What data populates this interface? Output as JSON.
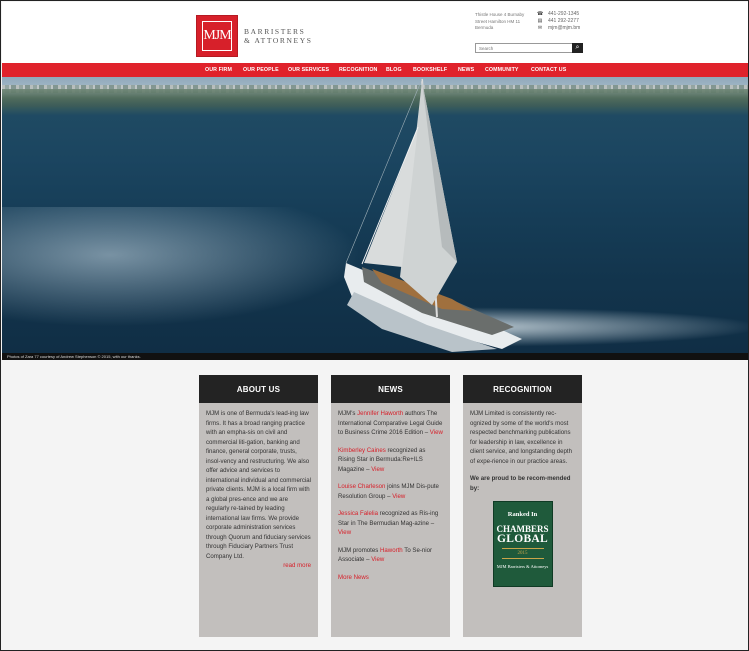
{
  "header": {
    "logo_mark": "MJM",
    "logo_text_line1": "BARRISTERS",
    "logo_text_line2": "& ATTORNEYS",
    "address_lines": [
      "Thistle House 4 Burnaby",
      "Street Hamilton HM 11",
      "Bermuda"
    ],
    "contacts": [
      {
        "icon": "phone-icon",
        "glyph": "☎",
        "text": "441-292-1345"
      },
      {
        "icon": "fax-icon",
        "glyph": "▤",
        "text": "441 292-2277"
      },
      {
        "icon": "email-icon",
        "glyph": "✉",
        "text": "mjm@mjm.bm"
      }
    ],
    "search": {
      "placeholder": "Search",
      "button_glyph": "⌕"
    }
  },
  "nav": {
    "items": [
      "OUR FIRM",
      "OUR PEOPLE",
      "OUR SERVICES",
      "RECOGNITION",
      "BLOG",
      "BOOKSHELF",
      "NEWS",
      "COMMUNITY",
      "CONTACT US"
    ]
  },
  "hero": {
    "caption": "Photos of Zara 77 courtesy of Andrew Stephenson © 2015, with our thanks.",
    "slide_count": 3,
    "active_slide": 1
  },
  "about": {
    "title": "ABOUT US",
    "text": "MJM is one of Bermuda's lead-ing law firms. It has a broad ranging practice with an empha-sis on civil and commercial liti-gation, banking and finance, general corporate, trusts, insol-vency and restructuring. We also offer advice and services to international individual and commercial private clients. MJM is a local firm with a global pres-ence and we are regularly re-tained by leading international law firms. We provide corporate administration services through Quorum and fiduciary services through Fiduciary Partners Trust Company Ltd.",
    "read_more": "read more"
  },
  "news": {
    "title": "NEWS",
    "items": [
      {
        "pre": "MJM's ",
        "highlight": "Jennifer Haworth",
        "post": " authors The International Comparative Legal Guide to Business Crime 2016 Edition – ",
        "link": "View"
      },
      {
        "pre": "",
        "highlight": "Kimberley Caines",
        "post": " recognized as Rising Star in Bermuda:Re+ILS Magazine – ",
        "link": "View"
      },
      {
        "pre": "",
        "highlight": "Louise Charleson",
        "post": " joins MJM Dis-pute Resolution Group – ",
        "link": "View"
      },
      {
        "pre": "",
        "highlight": "Jessica Falelia",
        "post": " recognized as Ris-ing Star in The Bermudian Mag-azine – ",
        "link": "View"
      },
      {
        "pre": "MJM promotes ",
        "highlight": "Haworth",
        "post": " To Se-nior Associate – ",
        "link": "View"
      }
    ],
    "more": "More News"
  },
  "recognition": {
    "title": "RECOGNITION",
    "text": "MJM Limited is consistently rec-ognized by some of the world's most respected benchmarking publications for leadership in law, excellence in client service, and longstanding depth of expe-rience in our practice areas.",
    "bold_text": "We are proud to be recom-mended by:",
    "badge": {
      "line1": "Ranked In",
      "line2": "CHAMBERS",
      "line3": "GLOBAL",
      "line4": "2015",
      "line5": "MJM Barristers & Attorneys"
    }
  },
  "colors": {
    "accent": "#e0222b",
    "dark": "#232323",
    "panel": "#c2bfbd",
    "badge_green": "#1f5a3b"
  }
}
